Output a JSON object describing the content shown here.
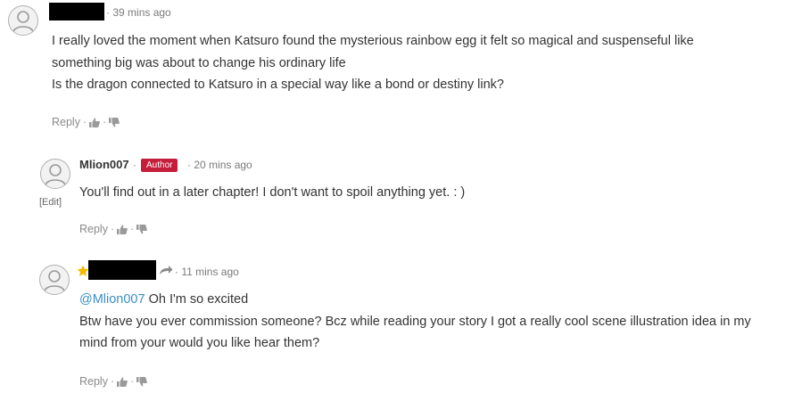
{
  "comments": [
    {
      "author": "",
      "time": "39 mins ago",
      "lines": [
        "I really loved the moment when Katsuro found the mysterious rainbow egg it felt so magical and suspenseful like",
        "something big was about to change his ordinary life",
        "Is the dragon connected to Katsuro in a special way like a bond or destiny link?"
      ],
      "reply_label": "Reply"
    },
    {
      "author": "Mlion007",
      "badge": "Author",
      "time": "20 mins ago",
      "edit_label": "[Edit]",
      "lines": [
        "You'll find out in a later chapter! I don't want to spoil anything yet. : )"
      ],
      "reply_label": "Reply"
    },
    {
      "author": "",
      "time": "11 mins ago",
      "mention": "@Mlion007",
      "first_line_rest": " Oh I'm so excited",
      "lines": [
        "Btw have you ever commission someone? Bcz while reading your story I got a really cool scene illustration idea in my",
        "mind from your would you like hear them?"
      ],
      "reply_label": "Reply"
    }
  ],
  "colors": {
    "badge": "#c51d3a",
    "mention": "#3a8fc4",
    "star": "#f5b800"
  },
  "icons": [
    "user-avatar-icon",
    "thumbs-up-icon",
    "thumbs-down-icon",
    "star-icon",
    "reply-arrow-icon"
  ]
}
